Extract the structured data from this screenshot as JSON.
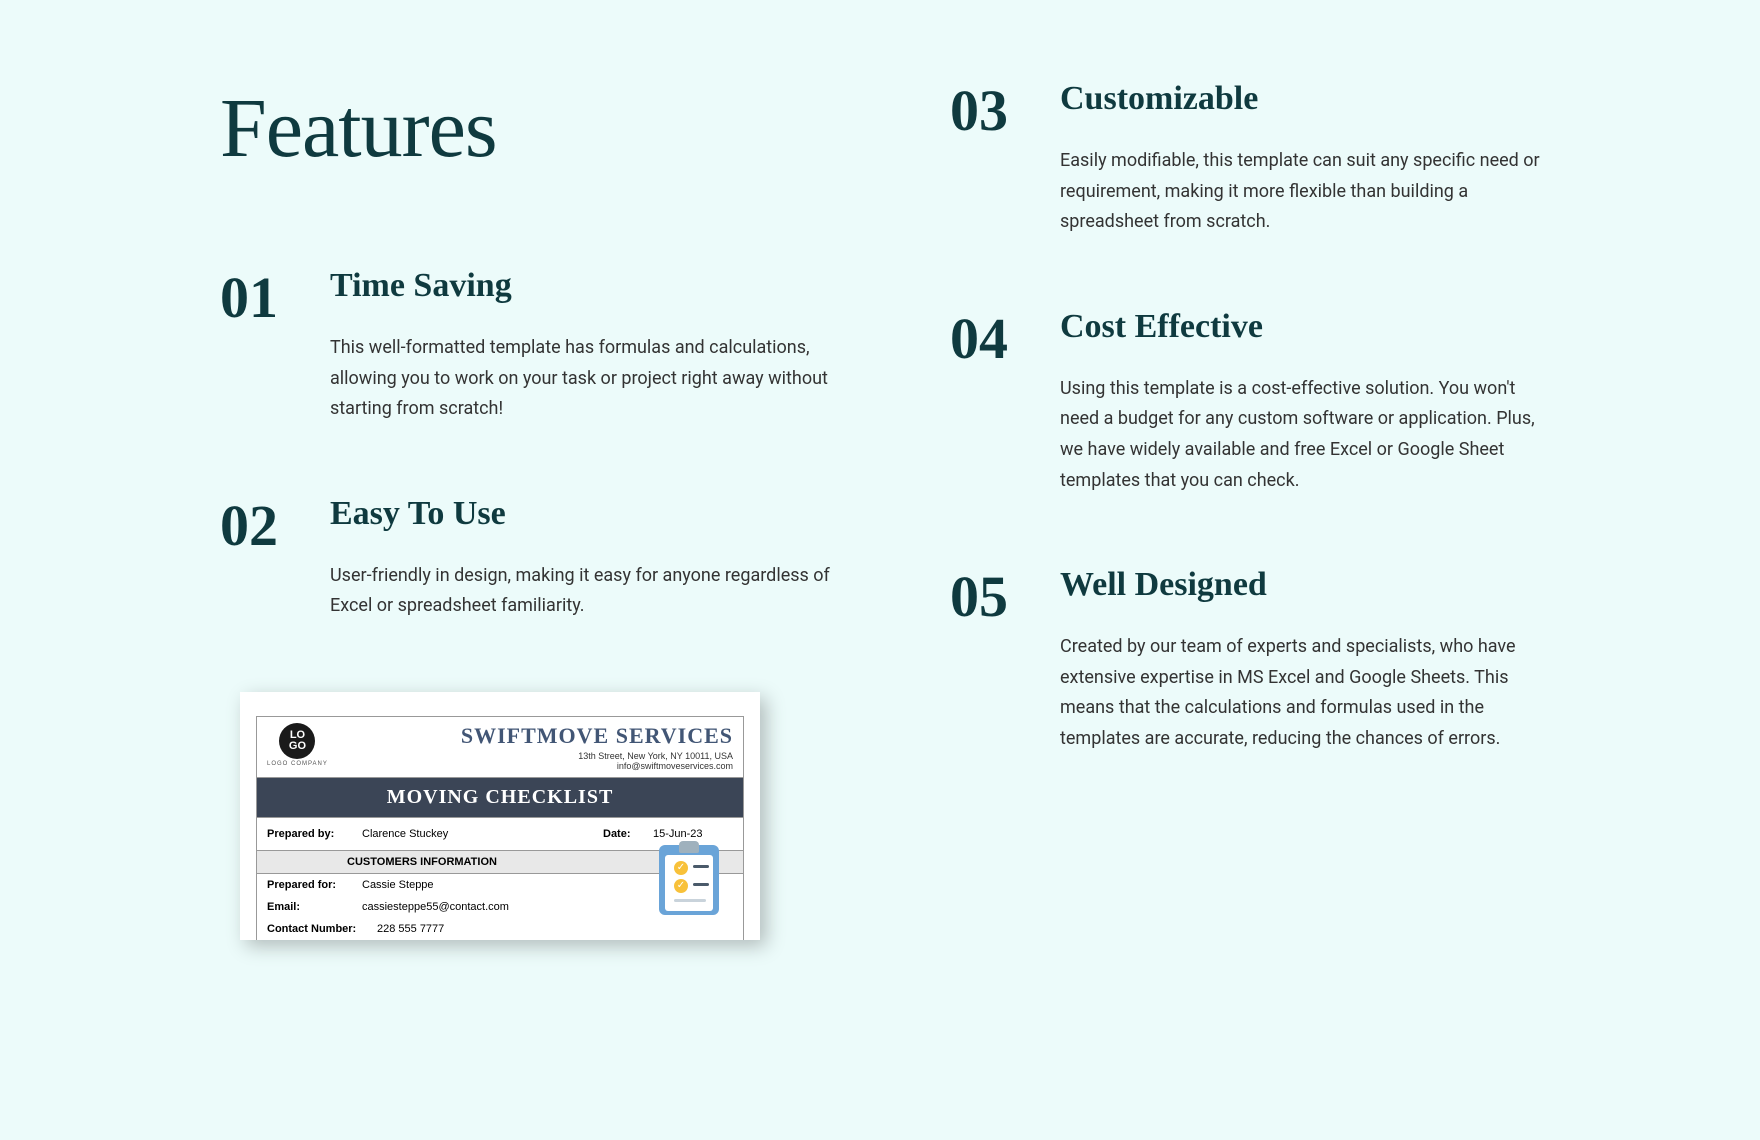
{
  "heading": "Features",
  "features": [
    {
      "num": "01",
      "title": "Time Saving",
      "desc": "This well-formatted template has formulas and calculations, allowing you to work on your task or project right away without starting from scratch!"
    },
    {
      "num": "02",
      "title": "Easy To Use",
      "desc": "User-friendly in design, making it easy for anyone regardless of Excel or spreadsheet familiarity."
    },
    {
      "num": "03",
      "title": "Customizable",
      "desc": "Easily modifiable, this template can suit any specific need or requirement, making it more flexible than building a spreadsheet from scratch."
    },
    {
      "num": "04",
      "title": "Cost Effective",
      "desc": "Using this template is a cost-effective solution. You won't need a budget for any custom software or application. Plus, we have widely available and free Excel or Google Sheet templates that you can check."
    },
    {
      "num": "05",
      "title": "Well Designed",
      "desc": "Created by our team of  experts and specialists, who have extensive expertise in MS Excel and Google Sheets. This means that the calculations and formulas used in the templates are accurate, reducing the chances of errors."
    }
  ],
  "preview": {
    "logo_text": "LO\nGO",
    "logo_sub": "LOGO COMPANY",
    "company_name": "SWIFTMOVE SERVICES",
    "company_addr": "13th Street, New York, NY 10011, USA",
    "company_email": "info@swiftmoveservices.com",
    "checklist_title": "MOVING CHECKLIST",
    "prepared_by_label": "Prepared by:",
    "prepared_by_value": "Clarence Stuckey",
    "date_label": "Date:",
    "date_value": "15-Jun-23",
    "customers_section": "CUSTOMERS INFORMATION",
    "prepared_for_label": "Prepared for:",
    "prepared_for_value": "Cassie Steppe",
    "email_label": "Email:",
    "email_value": "cassiesteppe55@contact.com",
    "contact_label": "Contact Number:",
    "contact_value": "228 555 7777"
  }
}
